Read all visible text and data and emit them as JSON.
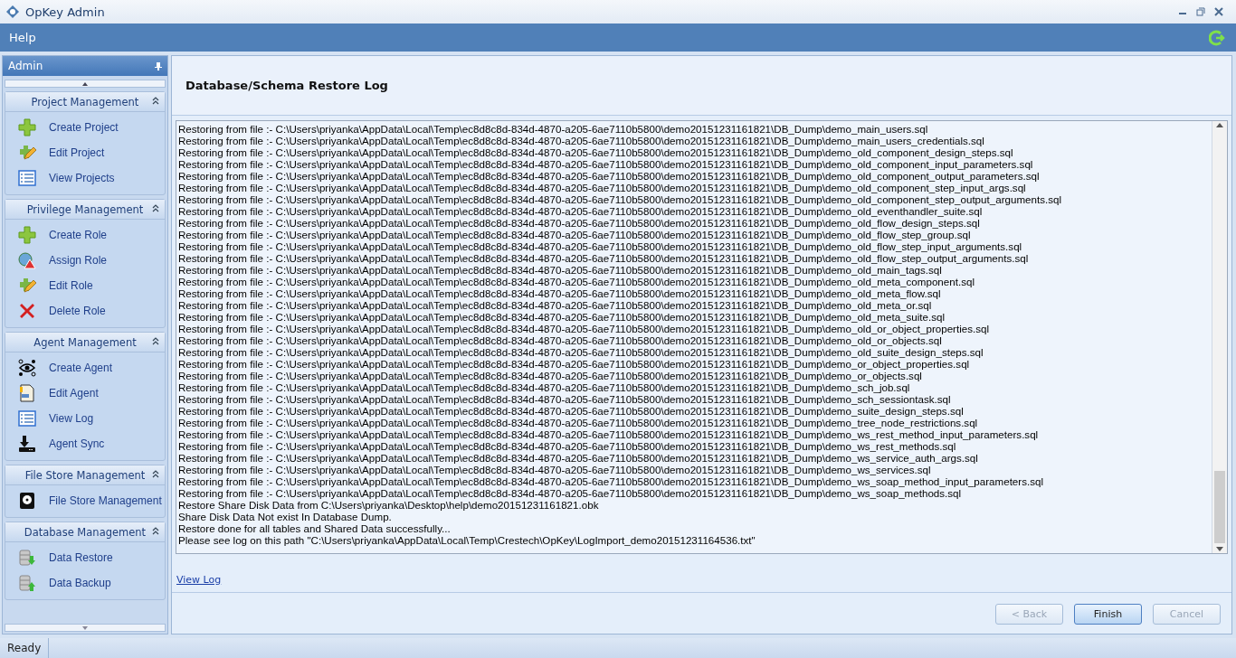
{
  "window": {
    "title": "OpKey Admin"
  },
  "menu": [
    {
      "label": "Help"
    }
  ],
  "sidebar": {
    "title": "Admin",
    "groups": [
      {
        "title": "Project Management",
        "items": [
          {
            "label": "Create Project"
          },
          {
            "label": "Edit Project"
          },
          {
            "label": "View Projects"
          }
        ]
      },
      {
        "title": "Privilege Management",
        "items": [
          {
            "label": "Create Role"
          },
          {
            "label": "Assign Role"
          },
          {
            "label": "Edit Role"
          },
          {
            "label": "Delete Role"
          }
        ]
      },
      {
        "title": "Agent Management",
        "items": [
          {
            "label": "Create Agent"
          },
          {
            "label": "Edit Agent"
          },
          {
            "label": "View Log"
          },
          {
            "label": "Agent Sync"
          }
        ]
      },
      {
        "title": "File Store Management",
        "items": [
          {
            "label": "File Store Management"
          }
        ]
      },
      {
        "title": "Database Management",
        "items": [
          {
            "label": "Data Restore"
          },
          {
            "label": "Data Backup"
          }
        ]
      }
    ]
  },
  "content": {
    "title": "Database/Schema Restore Log",
    "log_lines": [
      "Restoring from file :- C:\\Users\\priyanka\\AppData\\Local\\Temp\\ec8d8c8d-834d-4870-a205-6ae7110b5800\\demo20151231161821\\DB_Dump\\demo_main_users.sql",
      "Restoring from file :- C:\\Users\\priyanka\\AppData\\Local\\Temp\\ec8d8c8d-834d-4870-a205-6ae7110b5800\\demo20151231161821\\DB_Dump\\demo_main_users_credentials.sql",
      "Restoring from file :- C:\\Users\\priyanka\\AppData\\Local\\Temp\\ec8d8c8d-834d-4870-a205-6ae7110b5800\\demo20151231161821\\DB_Dump\\demo_old_component_design_steps.sql",
      "Restoring from file :- C:\\Users\\priyanka\\AppData\\Local\\Temp\\ec8d8c8d-834d-4870-a205-6ae7110b5800\\demo20151231161821\\DB_Dump\\demo_old_component_input_parameters.sql",
      "Restoring from file :- C:\\Users\\priyanka\\AppData\\Local\\Temp\\ec8d8c8d-834d-4870-a205-6ae7110b5800\\demo20151231161821\\DB_Dump\\demo_old_component_output_parameters.sql",
      "Restoring from file :- C:\\Users\\priyanka\\AppData\\Local\\Temp\\ec8d8c8d-834d-4870-a205-6ae7110b5800\\demo20151231161821\\DB_Dump\\demo_old_component_step_input_args.sql",
      "Restoring from file :- C:\\Users\\priyanka\\AppData\\Local\\Temp\\ec8d8c8d-834d-4870-a205-6ae7110b5800\\demo20151231161821\\DB_Dump\\demo_old_component_step_output_arguments.sql",
      "Restoring from file :- C:\\Users\\priyanka\\AppData\\Local\\Temp\\ec8d8c8d-834d-4870-a205-6ae7110b5800\\demo20151231161821\\DB_Dump\\demo_old_eventhandler_suite.sql",
      "Restoring from file :- C:\\Users\\priyanka\\AppData\\Local\\Temp\\ec8d8c8d-834d-4870-a205-6ae7110b5800\\demo20151231161821\\DB_Dump\\demo_old_flow_design_steps.sql",
      "Restoring from file :- C:\\Users\\priyanka\\AppData\\Local\\Temp\\ec8d8c8d-834d-4870-a205-6ae7110b5800\\demo20151231161821\\DB_Dump\\demo_old_flow_step_group.sql",
      "Restoring from file :- C:\\Users\\priyanka\\AppData\\Local\\Temp\\ec8d8c8d-834d-4870-a205-6ae7110b5800\\demo20151231161821\\DB_Dump\\demo_old_flow_step_input_arguments.sql",
      "Restoring from file :- C:\\Users\\priyanka\\AppData\\Local\\Temp\\ec8d8c8d-834d-4870-a205-6ae7110b5800\\demo20151231161821\\DB_Dump\\demo_old_flow_step_output_arguments.sql",
      "Restoring from file :- C:\\Users\\priyanka\\AppData\\Local\\Temp\\ec8d8c8d-834d-4870-a205-6ae7110b5800\\demo20151231161821\\DB_Dump\\demo_old_main_tags.sql",
      "Restoring from file :- C:\\Users\\priyanka\\AppData\\Local\\Temp\\ec8d8c8d-834d-4870-a205-6ae7110b5800\\demo20151231161821\\DB_Dump\\demo_old_meta_component.sql",
      "Restoring from file :- C:\\Users\\priyanka\\AppData\\Local\\Temp\\ec8d8c8d-834d-4870-a205-6ae7110b5800\\demo20151231161821\\DB_Dump\\demo_old_meta_flow.sql",
      "Restoring from file :- C:\\Users\\priyanka\\AppData\\Local\\Temp\\ec8d8c8d-834d-4870-a205-6ae7110b5800\\demo20151231161821\\DB_Dump\\demo_old_meta_or.sql",
      "Restoring from file :- C:\\Users\\priyanka\\AppData\\Local\\Temp\\ec8d8c8d-834d-4870-a205-6ae7110b5800\\demo20151231161821\\DB_Dump\\demo_old_meta_suite.sql",
      "Restoring from file :- C:\\Users\\priyanka\\AppData\\Local\\Temp\\ec8d8c8d-834d-4870-a205-6ae7110b5800\\demo20151231161821\\DB_Dump\\demo_old_or_object_properties.sql",
      "Restoring from file :- C:\\Users\\priyanka\\AppData\\Local\\Temp\\ec8d8c8d-834d-4870-a205-6ae7110b5800\\demo20151231161821\\DB_Dump\\demo_old_or_objects.sql",
      "Restoring from file :- C:\\Users\\priyanka\\AppData\\Local\\Temp\\ec8d8c8d-834d-4870-a205-6ae7110b5800\\demo20151231161821\\DB_Dump\\demo_old_suite_design_steps.sql",
      "Restoring from file :- C:\\Users\\priyanka\\AppData\\Local\\Temp\\ec8d8c8d-834d-4870-a205-6ae7110b5800\\demo20151231161821\\DB_Dump\\demo_or_object_properties.sql",
      "Restoring from file :- C:\\Users\\priyanka\\AppData\\Local\\Temp\\ec8d8c8d-834d-4870-a205-6ae7110b5800\\demo20151231161821\\DB_Dump\\demo_or_objects.sql",
      "Restoring from file :- C:\\Users\\priyanka\\AppData\\Local\\Temp\\ec8d8c8d-834d-4870-a205-6ae7110b5800\\demo20151231161821\\DB_Dump\\demo_sch_job.sql",
      "Restoring from file :- C:\\Users\\priyanka\\AppData\\Local\\Temp\\ec8d8c8d-834d-4870-a205-6ae7110b5800\\demo20151231161821\\DB_Dump\\demo_sch_sessiontask.sql",
      "Restoring from file :- C:\\Users\\priyanka\\AppData\\Local\\Temp\\ec8d8c8d-834d-4870-a205-6ae7110b5800\\demo20151231161821\\DB_Dump\\demo_suite_design_steps.sql",
      "Restoring from file :- C:\\Users\\priyanka\\AppData\\Local\\Temp\\ec8d8c8d-834d-4870-a205-6ae7110b5800\\demo20151231161821\\DB_Dump\\demo_tree_node_restrictions.sql",
      "Restoring from file :- C:\\Users\\priyanka\\AppData\\Local\\Temp\\ec8d8c8d-834d-4870-a205-6ae7110b5800\\demo20151231161821\\DB_Dump\\demo_ws_rest_method_input_parameters.sql",
      "Restoring from file :- C:\\Users\\priyanka\\AppData\\Local\\Temp\\ec8d8c8d-834d-4870-a205-6ae7110b5800\\demo20151231161821\\DB_Dump\\demo_ws_rest_methods.sql",
      "Restoring from file :- C:\\Users\\priyanka\\AppData\\Local\\Temp\\ec8d8c8d-834d-4870-a205-6ae7110b5800\\demo20151231161821\\DB_Dump\\demo_ws_service_auth_args.sql",
      "Restoring from file :- C:\\Users\\priyanka\\AppData\\Local\\Temp\\ec8d8c8d-834d-4870-a205-6ae7110b5800\\demo20151231161821\\DB_Dump\\demo_ws_services.sql",
      "Restoring from file :- C:\\Users\\priyanka\\AppData\\Local\\Temp\\ec8d8c8d-834d-4870-a205-6ae7110b5800\\demo20151231161821\\DB_Dump\\demo_ws_soap_method_input_parameters.sql",
      "Restoring from file :- C:\\Users\\priyanka\\AppData\\Local\\Temp\\ec8d8c8d-834d-4870-a205-6ae7110b5800\\demo20151231161821\\DB_Dump\\demo_ws_soap_methods.sql",
      "Restore Share Disk Data from C:\\Users\\priyanka\\Desktop\\help\\demo20151231161821.obk",
      "Share Disk Data Not exist In Database Dump.",
      "Restore done for all tables and Shared Data successfully...",
      "Please see log on this path  \"C:\\Users\\priyanka\\AppData\\Local\\Temp\\Crestech\\OpKey\\LogImport_demo20151231164536.txt\""
    ],
    "link": "View Log",
    "buttons": [
      {
        "label": "< Back",
        "disabled": true,
        "default": false
      },
      {
        "label": "Finish",
        "disabled": false,
        "default": true
      },
      {
        "label": "Cancel",
        "disabled": true,
        "default": false
      }
    ]
  },
  "status_bar": {
    "text": "Ready"
  }
}
